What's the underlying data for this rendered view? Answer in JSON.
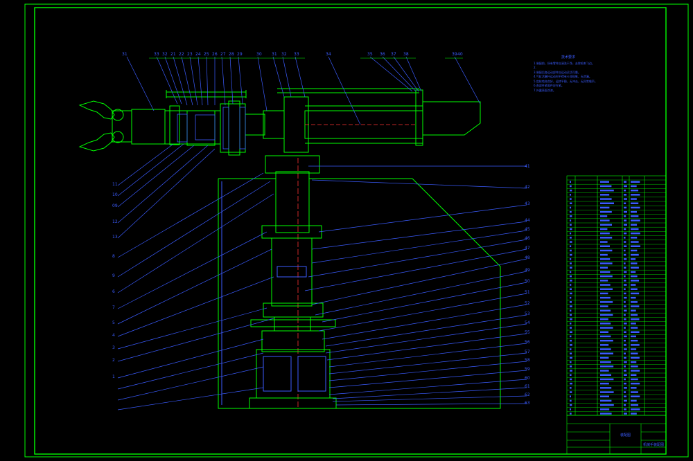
{
  "drawing": {
    "notes_title": "技术要求",
    "notes": [
      "1.装配前，所有零件应清洗干净，去除毛刺飞边。",
      "2.",
      "3.装配后各运动部件应运动灵活可靠。",
      "4.气缸活塞杆运动时不得有卡滞现象，无泄漏。",
      "5.齿轮啮合良好，运转平稳，无冲击，无异常噪声。",
      "6.各部件紧固件应拧紧。",
      "7.外露表面涂漆。"
    ],
    "part_labels_top": [
      "31",
      "33",
      "32",
      "21",
      "22",
      "23",
      "24",
      "25",
      "26",
      "27",
      "28",
      "29",
      "30",
      "31",
      "32",
      "33",
      "34",
      "35",
      "36",
      "37",
      "38",
      "39",
      "40"
    ],
    "part_labels_left": [
      "11",
      "10",
      "09",
      "12",
      "13",
      "8",
      "9",
      "6",
      "7",
      "5",
      "4",
      "3",
      "2",
      "1"
    ],
    "part_labels_right": [
      "41",
      "42",
      "43",
      "44",
      "45",
      "46",
      "47",
      "48",
      "49",
      "50",
      "51",
      "52",
      "53",
      "54",
      "55",
      "56",
      "57",
      "58",
      "59",
      "60",
      "61",
      "62",
      "63"
    ],
    "title_block": {
      "drawing_title": "机械手装配图",
      "sheet": "装配图"
    }
  }
}
